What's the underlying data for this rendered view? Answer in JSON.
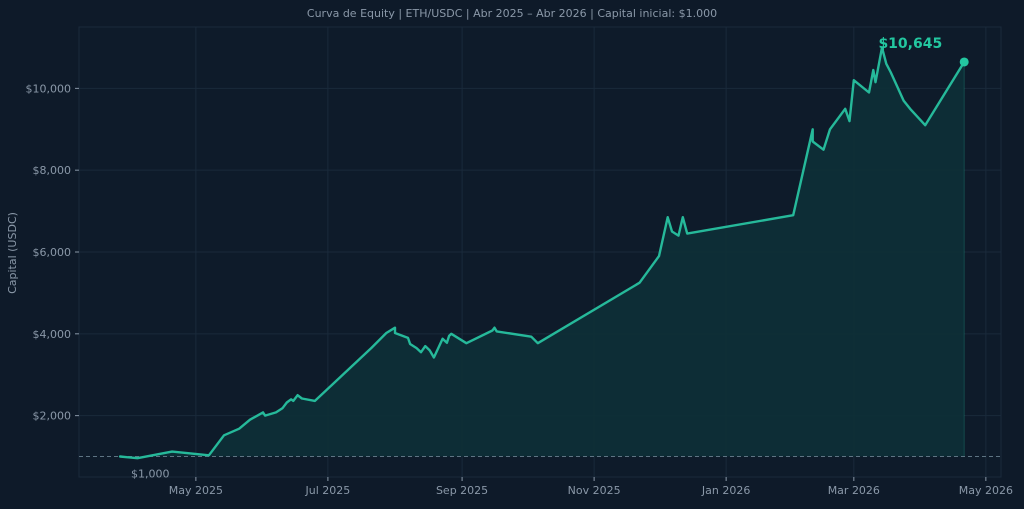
{
  "colors": {
    "background": "#0e1a29",
    "plot_background": "#0e1b2a",
    "line": "#26b99a",
    "fill": "#0d3037",
    "grid": "#1a2a3b",
    "axis_text": "#8a98a8",
    "baseline": "#5e7483",
    "highlight": "#23c7a0"
  },
  "chart_data": {
    "type": "area",
    "title": "Curva de Equity  |  ETH/USDC  |  Abr 2025 – Abr 2026  |  Capital inicial: $1.000",
    "xlabel": "",
    "ylabel": "Capital (USDC)",
    "xlim": [
      "2025-03-08",
      "2026-05-08"
    ],
    "ylim": [
      500,
      11500
    ],
    "grid": true,
    "x_ticks": [
      {
        "date": "2025-05-01",
        "label": "May 2025"
      },
      {
        "date": "2025-07-01",
        "label": "Jul 2025"
      },
      {
        "date": "2025-09-01",
        "label": "Sep 2025"
      },
      {
        "date": "2025-11-01",
        "label": "Nov 2025"
      },
      {
        "date": "2026-01-01",
        "label": "Jan 2026"
      },
      {
        "date": "2026-03-01",
        "label": "Mar 2026"
      },
      {
        "date": "2026-05-01",
        "label": "May 2026"
      }
    ],
    "y_ticks": [
      {
        "value": 2000,
        "label": "$2,000"
      },
      {
        "value": 4000,
        "label": "$4,000"
      },
      {
        "value": 6000,
        "label": "$6,000"
      },
      {
        "value": 8000,
        "label": "$8,000"
      },
      {
        "value": 10000,
        "label": "$10,000"
      }
    ],
    "baseline": {
      "value": 1000,
      "label": "$1,000"
    },
    "final_label": "$10,645",
    "series": [
      {
        "x": [
          "2025-03-27",
          "2025-04-04",
          "2025-04-20",
          "2025-05-07",
          "2025-05-14",
          "2025-05-21",
          "2025-05-26",
          "2025-06-01",
          "2025-06-02",
          "2025-06-07",
          "2025-06-10",
          "2025-06-12",
          "2025-06-14",
          "2025-06-15",
          "2025-06-17",
          "2025-06-19",
          "2025-06-25",
          "2025-07-21",
          "2025-07-28",
          "2025-08-01",
          "2025-08-01",
          "2025-08-07",
          "2025-08-08",
          "2025-08-11",
          "2025-08-13",
          "2025-08-15",
          "2025-08-17",
          "2025-08-19",
          "2025-08-23",
          "2025-08-25",
          "2025-08-26",
          "2025-08-27",
          "2025-09-03",
          "2025-09-15",
          "2025-09-16",
          "2025-09-17",
          "2025-10-03",
          "2025-10-06",
          "2025-11-22",
          "2025-12-01",
          "2025-12-05",
          "2025-12-07",
          "2025-12-10",
          "2025-12-12",
          "2025-12-14",
          "2026-02-01",
          "2026-02-10",
          "2026-02-10",
          "2026-02-15",
          "2026-02-18",
          "2026-02-25",
          "2026-02-27",
          "2026-03-01",
          "2026-03-08",
          "2026-03-10",
          "2026-03-11",
          "2026-03-14",
          "2026-03-16",
          "2026-03-18",
          "2026-03-21",
          "2026-03-24",
          "2026-03-27",
          "2026-04-03",
          "2026-04-21"
        ],
        "values": [
          1000,
          960,
          1120,
          1030,
          1520,
          1680,
          1900,
          2080,
          2000,
          2080,
          2180,
          2320,
          2400,
          2360,
          2500,
          2420,
          2360,
          3650,
          4020,
          4150,
          4020,
          3900,
          3750,
          3650,
          3550,
          3700,
          3600,
          3420,
          3880,
          3780,
          3950,
          4000,
          3770,
          4080,
          4150,
          4060,
          3930,
          3770,
          5250,
          5900,
          6850,
          6500,
          6400,
          6850,
          6450,
          6900,
          9000,
          8700,
          8500,
          9000,
          9500,
          9200,
          10200,
          9900,
          10450,
          10150,
          11000,
          10600,
          10400,
          10050,
          9700,
          9500,
          9100,
          10645
        ]
      }
    ]
  }
}
